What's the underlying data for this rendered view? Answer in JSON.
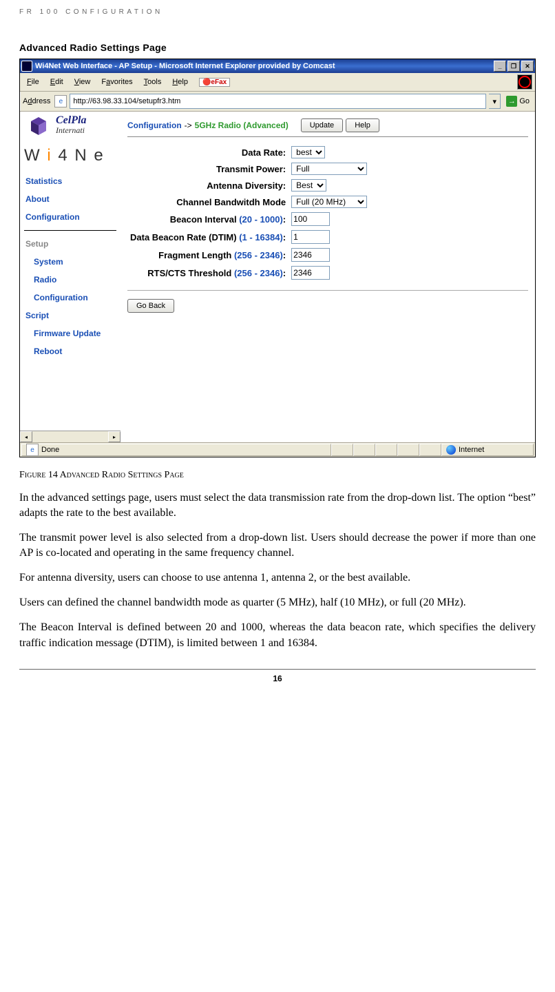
{
  "doc": {
    "header": "FR 100 CONFIGURATION",
    "section_heading": "Advanced Radio Settings Page",
    "figure_caption": "Figure 14 Advanced Radio Settings Page",
    "p1": "In the advanced settings page, users must select the data transmission rate from the drop-down list. The option “best” adapts the rate to the best available.",
    "p2": "The transmit power level is also selected from a drop-down list. Users should decrease the power if more than one AP is co-located and operating in the same frequency channel.",
    "p3": "For antenna diversity, users can choose to use antenna 1, antenna 2, or the best available.",
    "p4": "Users can defined the channel bandwidth mode as quarter (5 MHz), half (10 MHz), or full (20 MHz).",
    "p5": "The Beacon Interval is defined between 20 and 1000, whereas the data beacon rate, which specifies the delivery traffic indication message (DTIM), is limited between 1 and 16384.",
    "page_number": "16"
  },
  "browser": {
    "title": "Wi4Net Web Interface - AP Setup - Microsoft Internet Explorer provided by Comcast",
    "menu": {
      "file": "File",
      "edit": "Edit",
      "view": "View",
      "favorites": "Favorites",
      "tools": "Tools",
      "help": "Help",
      "efax": "eFax"
    },
    "address_label": "Address",
    "url": "http://63.98.33.104/setupfr3.htm",
    "go_label": "Go",
    "status_done": "Done",
    "status_zone": "Internet"
  },
  "sidebar": {
    "celpla": "CelPla",
    "intern": "Internati",
    "wi4": "W i 4 N e",
    "links": {
      "stats": "Statistics",
      "about": "About",
      "config": "Configuration",
      "setup": "Setup",
      "system": "System",
      "radio": "Radio",
      "cfgscript1": "Configuration",
      "cfgscript2": "Script",
      "firmware": "Firmware Update",
      "reboot": "Reboot"
    }
  },
  "breadcrumb": {
    "config": "Configuration",
    "arrow": "->",
    "section": "5GHz Radio (Advanced)",
    "update": "Update",
    "help": "Help"
  },
  "form": {
    "data_rate": {
      "label": "Data Rate:",
      "value": "best"
    },
    "tx_power": {
      "label": "Transmit Power:",
      "value": "Full"
    },
    "ant_div": {
      "label": "Antenna Diversity:",
      "value": "Best"
    },
    "chan_bw": {
      "label": "Channel Bandwitdh Mode",
      "value": "Full (20 MHz)"
    },
    "beacon": {
      "label": "Beacon Interval",
      "range": "(20 - 1000)",
      "colon": ":",
      "value": "100"
    },
    "dtim": {
      "label": "Data Beacon Rate (DTIM)",
      "range": "(1 - 16384)",
      "colon": ":",
      "value": "1"
    },
    "frag": {
      "label": "Fragment Length",
      "range": "(256 - 2346)",
      "colon": ":",
      "value": "2346"
    },
    "rts": {
      "label": "RTS/CTS Threshold",
      "range": "(256 - 2346)",
      "colon": ":",
      "value": "2346"
    },
    "goback": "Go Back"
  }
}
